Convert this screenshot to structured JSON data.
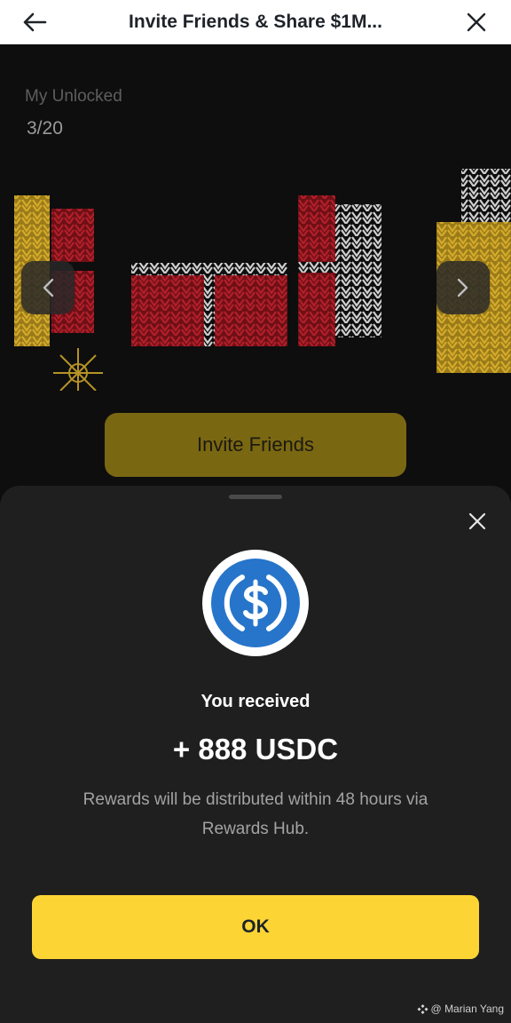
{
  "header": {
    "back_icon": "arrow-left-icon",
    "title": "Invite Friends & Share $1M...",
    "close_icon": "close-icon"
  },
  "background": {
    "unlocked_label": "My Unlocked",
    "unlocked_count": "3/20",
    "prev_icon": "chevron-left-icon",
    "next_icon": "chevron-right-icon",
    "invite_button": "Invite Friends",
    "colors": {
      "gold": "#c9a227",
      "red": "#9e1b24",
      "white": "#d9d9d9"
    }
  },
  "sheet": {
    "close_icon": "close-icon",
    "coin_icon": "usdc-coin-icon",
    "received_text": "You received",
    "amount_text": "+ 888 USDC",
    "note_text": "Rewards will be distributed within 48 hours via Rewards Hub.",
    "ok_label": "OK",
    "colors": {
      "accent": "#fcd535",
      "usdc_blue": "#2775ca",
      "sheet_bg": "#1f1f1f"
    }
  },
  "watermark": {
    "icon": "binance-logo-icon",
    "text": "@ Marian Yang"
  }
}
